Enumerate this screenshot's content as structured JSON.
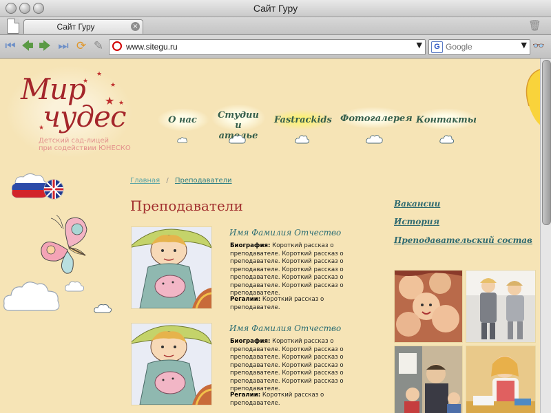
{
  "browser": {
    "window_title": "Сайт Гуру",
    "tab_label": "Сайт Гуру",
    "url": "www.sitegu.ru",
    "search_placeholder": "Google"
  },
  "site": {
    "logo_line1": "Мир",
    "logo_line2": "чудес",
    "logo_subtitle_line1": "Детский сад-лицей",
    "logo_subtitle_line2": "при содействии ЮНЕСКО",
    "nav": [
      {
        "label": "О нас"
      },
      {
        "label": "Студии",
        "label2": "и ателье"
      },
      {
        "label": "Fastrackids"
      },
      {
        "label": "Фотогалерея"
      },
      {
        "label": "Контакты"
      }
    ]
  },
  "breadcrumb": {
    "home": "Главная",
    "separator": "/",
    "current": "Преподаватели"
  },
  "page_title": "Преподаватели",
  "teachers": [
    {
      "name": "Имя Фамилия Отчество",
      "bio_label": "Биография:",
      "bio_text": " Короткий рассказ о преподавателе. Короткий рассказ о преподавателе. Короткий рассказ о преподавателе. Короткий рассказ о преподавателе. Короткий рассказ о преподавателе. Короткий рассказ о преподавателе.",
      "regalia_label": "Регалии:",
      "regalia_text": " Короткий рассказ о преподавателе."
    },
    {
      "name": "Имя Фамилия Отчество",
      "bio_label": "Биография:",
      "bio_text": " Короткий рассказ о преподавателе. Короткий рассказ о преподавателе. Короткий рассказ о преподавателе. Короткий рассказ о преподавателе. Короткий рассказ о преподавателе. Короткий рассказ о преподавателе.",
      "regalia_label": "Регалии:",
      "regalia_text": " Короткий рассказ о преподавателе."
    }
  ],
  "sidebar_links": [
    {
      "label": "Вакансии"
    },
    {
      "label": "История"
    },
    {
      "label": "Преподавательский состав"
    }
  ],
  "icons": {
    "back": "back-icon",
    "forward": "forward-icon",
    "reload": "reload-icon",
    "search_engine": "google-icon"
  },
  "colors": {
    "page_bg": "#f6e4b6",
    "title": "#a2302f",
    "nav": "#355e4b",
    "link": "#2f6a70"
  }
}
